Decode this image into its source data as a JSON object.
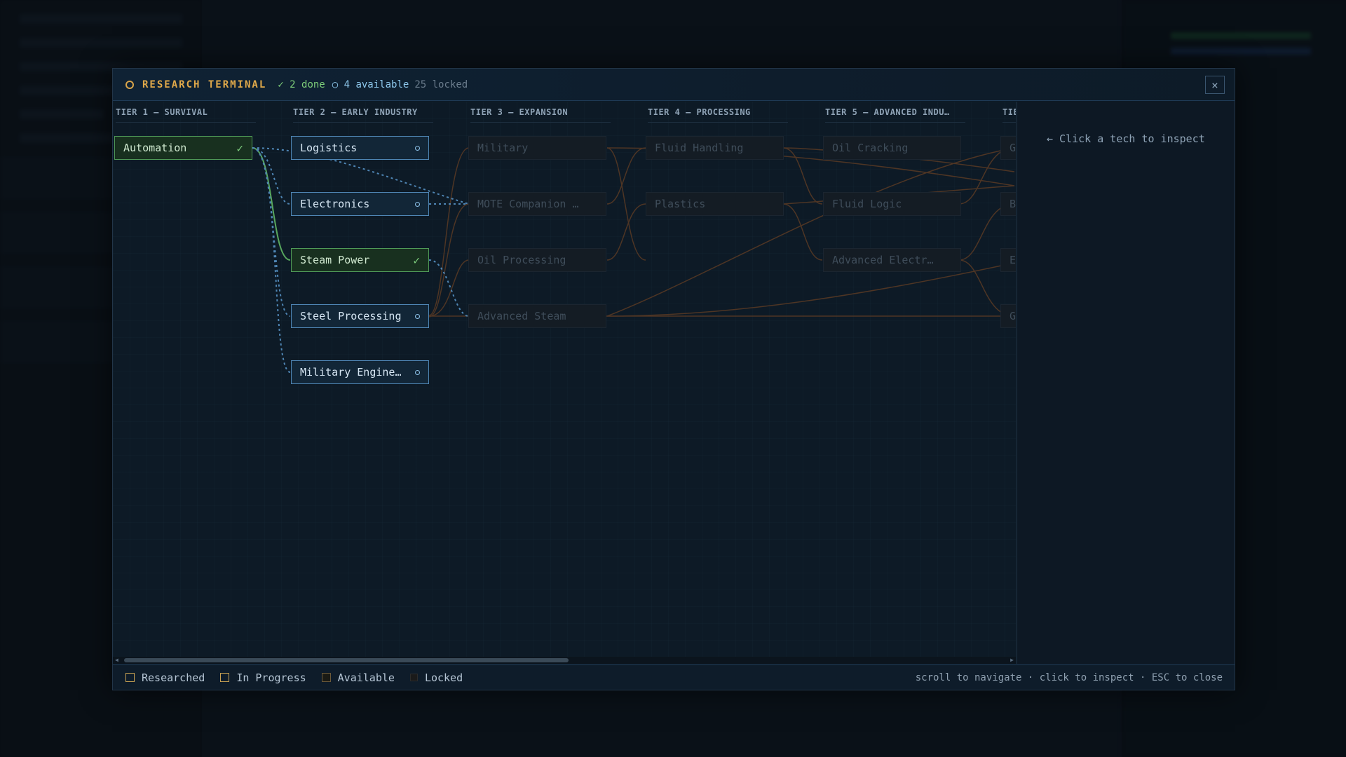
{
  "header": {
    "title": "RESEARCH TERMINAL",
    "done": "✓ 2 done",
    "available": "○ 4 available",
    "locked": "25 locked",
    "close_label": "×"
  },
  "tiers": [
    {
      "label": "TIER 1 — SURVIVAL"
    },
    {
      "label": "TIER 2 — EARLY INDUSTRY"
    },
    {
      "label": "TIER 3 — EXPANSION"
    },
    {
      "label": "TIER 4 — PROCESSING"
    },
    {
      "label": "TIER 5 — ADVANCED INDU…"
    },
    {
      "label": "TIE"
    }
  ],
  "nodes": {
    "automation": {
      "label": "Automation",
      "status": "researched",
      "mark": "✓"
    },
    "logistics": {
      "label": "Logistics",
      "status": "available"
    },
    "electronics": {
      "label": "Electronics",
      "status": "available"
    },
    "steam_power": {
      "label": "Steam Power",
      "status": "researched",
      "mark": "✓"
    },
    "steel_processing": {
      "label": "Steel Processing",
      "status": "available"
    },
    "military_engineering": {
      "label": "Military Engine…",
      "status": "available"
    },
    "military": {
      "label": "Military",
      "status": "locked"
    },
    "mote_companion": {
      "label": "MOTE Companion …",
      "status": "locked"
    },
    "oil_processing": {
      "label": "Oil Processing",
      "status": "locked"
    },
    "advanced_steam": {
      "label": "Advanced Steam",
      "status": "locked"
    },
    "fluid_handling": {
      "label": "Fluid Handling",
      "status": "locked"
    },
    "plastics": {
      "label": "Plastics",
      "status": "locked"
    },
    "oil_cracking": {
      "label": "Oil Cracking",
      "status": "locked"
    },
    "fluid_logic": {
      "label": "Fluid Logic",
      "status": "locked"
    },
    "advanced_electronics": {
      "label": "Advanced Electr…",
      "status": "locked"
    },
    "t6_a": {
      "label": "G",
      "status": "locked"
    },
    "t6_b": {
      "label": "B",
      "status": "locked"
    },
    "t6_c": {
      "label": "E",
      "status": "locked"
    },
    "t6_d": {
      "label": "G",
      "status": "locked"
    }
  },
  "inspector": {
    "hint": "← Click a tech to inspect"
  },
  "legend": {
    "researched": "Researched",
    "in_progress": "In Progress",
    "available": "Available",
    "locked": "Locked"
  },
  "footer": {
    "hint": "scroll to navigate · click to inspect · ESC to close"
  },
  "colors": {
    "accent": "#e0a94a",
    "researched": "#4f9a57",
    "available": "#4f86b5",
    "locked": "#1b2530",
    "locked_link": "#5a3a24"
  }
}
